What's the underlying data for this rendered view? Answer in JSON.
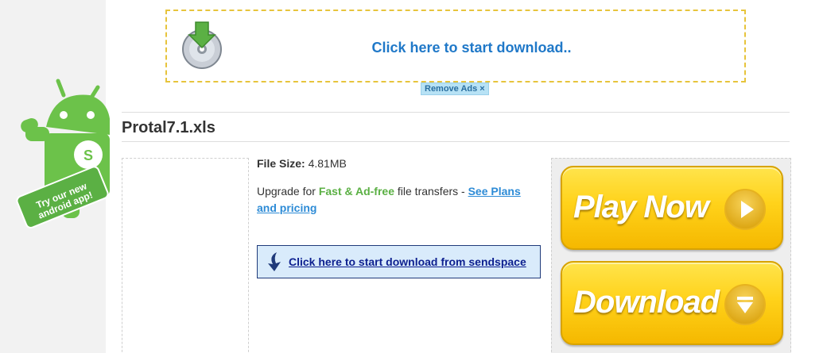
{
  "promo": {
    "text": "Try our new android app!"
  },
  "ad_banner": {
    "link_text": "Click here to start download..",
    "remove_ads_label": "Remove Ads",
    "remove_icon": "×"
  },
  "file": {
    "name": "Protal7.1.xls",
    "size_label": "File Size:",
    "size_value": "4.81MB"
  },
  "upgrade": {
    "prefix": "Upgrade for ",
    "highlight": "Fast & Ad-free",
    "suffix": " file transfers - ",
    "link": "See Plans and pricing"
  },
  "download": {
    "link_text": "Click here to start download from sendspace"
  },
  "side_ad": {
    "play_label": "Play Now",
    "download_label": "Download"
  },
  "colors": {
    "accent_blue": "#1f78c8",
    "green": "#5bb044",
    "button_yellow": "#ffd21a"
  }
}
